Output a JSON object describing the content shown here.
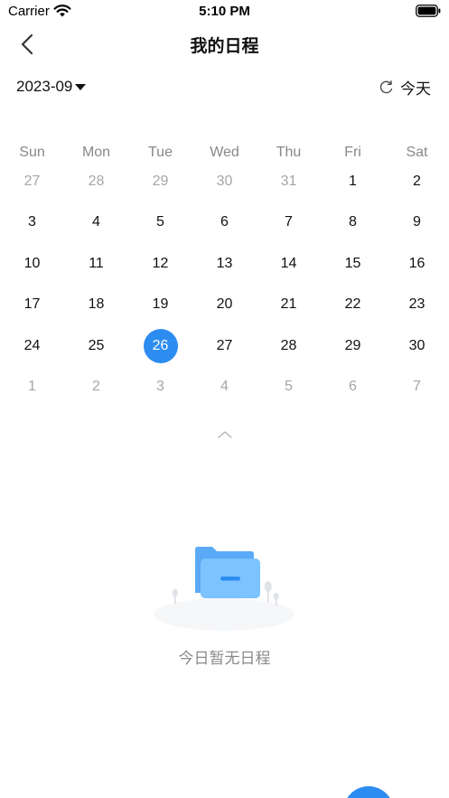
{
  "status_bar": {
    "carrier": "Carrier",
    "time": "5:10 PM"
  },
  "nav": {
    "title": "我的日程"
  },
  "month_picker": {
    "value": "2023-09"
  },
  "today_button": {
    "label": "今天"
  },
  "calendar": {
    "weekdays": [
      "Sun",
      "Mon",
      "Tue",
      "Wed",
      "Thu",
      "Fri",
      "Sat"
    ],
    "weeks": [
      [
        {
          "d": "27",
          "o": true
        },
        {
          "d": "28",
          "o": true
        },
        {
          "d": "29",
          "o": true
        },
        {
          "d": "30",
          "o": true
        },
        {
          "d": "31",
          "o": true
        },
        {
          "d": "1"
        },
        {
          "d": "2"
        }
      ],
      [
        {
          "d": "3"
        },
        {
          "d": "4"
        },
        {
          "d": "5"
        },
        {
          "d": "6"
        },
        {
          "d": "7"
        },
        {
          "d": "8"
        },
        {
          "d": "9"
        }
      ],
      [
        {
          "d": "10"
        },
        {
          "d": "11"
        },
        {
          "d": "12"
        },
        {
          "d": "13"
        },
        {
          "d": "14"
        },
        {
          "d": "15"
        },
        {
          "d": "16"
        }
      ],
      [
        {
          "d": "17"
        },
        {
          "d": "18"
        },
        {
          "d": "19"
        },
        {
          "d": "20"
        },
        {
          "d": "21"
        },
        {
          "d": "22"
        },
        {
          "d": "23"
        }
      ],
      [
        {
          "d": "24"
        },
        {
          "d": "25"
        },
        {
          "d": "26",
          "s": true
        },
        {
          "d": "27"
        },
        {
          "d": "28"
        },
        {
          "d": "29"
        },
        {
          "d": "30"
        }
      ],
      [
        {
          "d": "1",
          "o": true
        },
        {
          "d": "2",
          "o": true
        },
        {
          "d": "3",
          "o": true
        },
        {
          "d": "4",
          "o": true
        },
        {
          "d": "5",
          "o": true
        },
        {
          "d": "6",
          "o": true
        },
        {
          "d": "7",
          "o": true
        }
      ]
    ],
    "selected_date": "26"
  },
  "empty_state": {
    "message": "今日暂无日程"
  },
  "colors": {
    "accent": "#2d8cf0",
    "muted_text": "#a6a6a6",
    "folder": "#6cb8ff"
  },
  "icons": {
    "back": "chevron-left-icon",
    "caret": "caret-down-icon",
    "refresh": "refresh-icon",
    "collapse": "chevron-up-icon",
    "empty": "folder-icon"
  }
}
